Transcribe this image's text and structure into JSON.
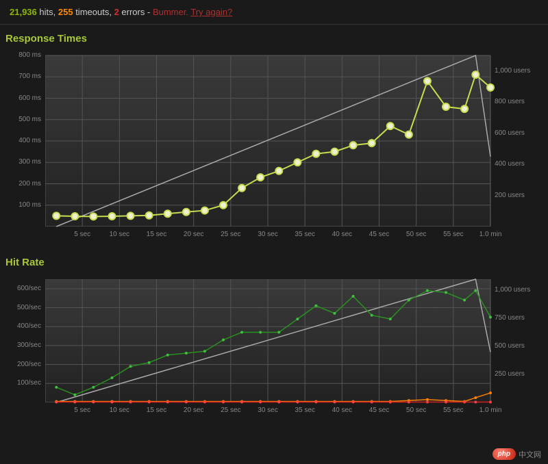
{
  "summary": {
    "hits_count": "21,936",
    "hits_label": "hits,",
    "timeouts_count": "255",
    "timeouts_label": "timeouts,",
    "errors_count": "2",
    "errors_label": "errors -",
    "bummer": "Bummer.",
    "try_again": "Try again?"
  },
  "response_times": {
    "title": "Response Times"
  },
  "hit_rate": {
    "title": "Hit Rate"
  },
  "watermark": {
    "badge": "php",
    "text": "中文网"
  },
  "chart_data": [
    {
      "type": "line",
      "title": "Response Times",
      "xlabel": "",
      "ylabel": "",
      "x_ticks": [
        "5 sec",
        "10 sec",
        "15 sec",
        "20 sec",
        "25 sec",
        "30 sec",
        "35 sec",
        "40 sec",
        "45 sec",
        "50 sec",
        "55 sec",
        "1.0 min"
      ],
      "y_left_ticks_ms": [
        100,
        200,
        300,
        400,
        500,
        600,
        700,
        800
      ],
      "y_left_suffix": " ms",
      "y_right_ticks_users": [
        200,
        400,
        600,
        800,
        1000
      ],
      "y_right_suffix": " users",
      "ylim_left": [
        0,
        800
      ],
      "ylim_right": [
        0,
        1100
      ],
      "xlim": [
        0,
        60
      ],
      "series": [
        {
          "name": "users",
          "axis": "right",
          "style": "gray",
          "x": [
            1.5,
            58,
            60
          ],
          "values": [
            0,
            1100,
            450
          ]
        },
        {
          "name": "response_ms",
          "axis": "left",
          "style": "yellow-green-dots",
          "x": [
            1.5,
            4,
            6.5,
            9,
            11.5,
            14,
            16.5,
            19,
            21.5,
            24,
            26.5,
            29,
            31.5,
            34,
            36.5,
            39,
            41.5,
            44,
            46.5,
            49,
            51.5,
            54,
            56.5,
            58,
            60
          ],
          "values": [
            50,
            48,
            47,
            48,
            50,
            52,
            60,
            68,
            75,
            100,
            180,
            230,
            260,
            300,
            340,
            350,
            380,
            390,
            470,
            430,
            680,
            560,
            550,
            710,
            650
          ]
        }
      ]
    },
    {
      "type": "line",
      "title": "Hit Rate",
      "xlabel": "",
      "ylabel": "",
      "x_ticks": [
        "5 sec",
        "10 sec",
        "15 sec",
        "20 sec",
        "25 sec",
        "30 sec",
        "35 sec",
        "40 sec",
        "45 sec",
        "50 sec",
        "55 sec",
        "1.0 min"
      ],
      "y_left_ticks_rate": [
        100,
        200,
        300,
        400,
        500,
        600
      ],
      "y_left_suffix": "/sec",
      "y_right_ticks_users": [
        250,
        500,
        750,
        1000
      ],
      "y_right_suffix": " users",
      "ylim_left": [
        0,
        650
      ],
      "ylim_right": [
        0,
        1100
      ],
      "xlim": [
        0,
        60
      ],
      "series": [
        {
          "name": "users",
          "axis": "right",
          "style": "gray",
          "x": [
            1.5,
            58,
            60
          ],
          "values": [
            0,
            1100,
            450
          ]
        },
        {
          "name": "hits_per_sec",
          "axis": "left",
          "style": "green-dots",
          "x": [
            1.5,
            4,
            6.5,
            9,
            11.5,
            14,
            16.5,
            19,
            21.5,
            24,
            26.5,
            29,
            31.5,
            34,
            36.5,
            39,
            41.5,
            44,
            46.5,
            49,
            51.5,
            54,
            56.5,
            58,
            60
          ],
          "values": [
            80,
            40,
            80,
            130,
            190,
            210,
            250,
            260,
            270,
            330,
            370,
            370,
            370,
            440,
            510,
            470,
            560,
            460,
            440,
            540,
            590,
            580,
            540,
            590,
            450
          ]
        },
        {
          "name": "timeouts_per_sec",
          "axis": "left",
          "style": "orange-dots",
          "x": [
            1.5,
            4,
            6.5,
            9,
            11.5,
            14,
            16.5,
            19,
            21.5,
            24,
            26.5,
            29,
            31.5,
            34,
            36.5,
            39,
            41.5,
            44,
            46.5,
            49,
            51.5,
            54,
            56.5,
            58,
            60
          ],
          "values": [
            5,
            5,
            5,
            5,
            5,
            5,
            5,
            5,
            5,
            5,
            5,
            5,
            5,
            5,
            5,
            5,
            5,
            5,
            5,
            10,
            15,
            10,
            5,
            25,
            50
          ]
        },
        {
          "name": "errors_per_sec",
          "axis": "left",
          "style": "red-dots",
          "x": [
            1.5,
            4,
            6.5,
            9,
            11.5,
            14,
            16.5,
            19,
            21.5,
            24,
            26.5,
            29,
            31.5,
            34,
            36.5,
            39,
            41.5,
            44,
            46.5,
            49,
            51.5,
            54,
            56.5,
            58,
            60
          ],
          "values": [
            2,
            2,
            2,
            2,
            2,
            2,
            2,
            2,
            2,
            2,
            2,
            2,
            2,
            2,
            2,
            2,
            2,
            2,
            2,
            2,
            2,
            2,
            2,
            2,
            2
          ]
        }
      ]
    }
  ]
}
